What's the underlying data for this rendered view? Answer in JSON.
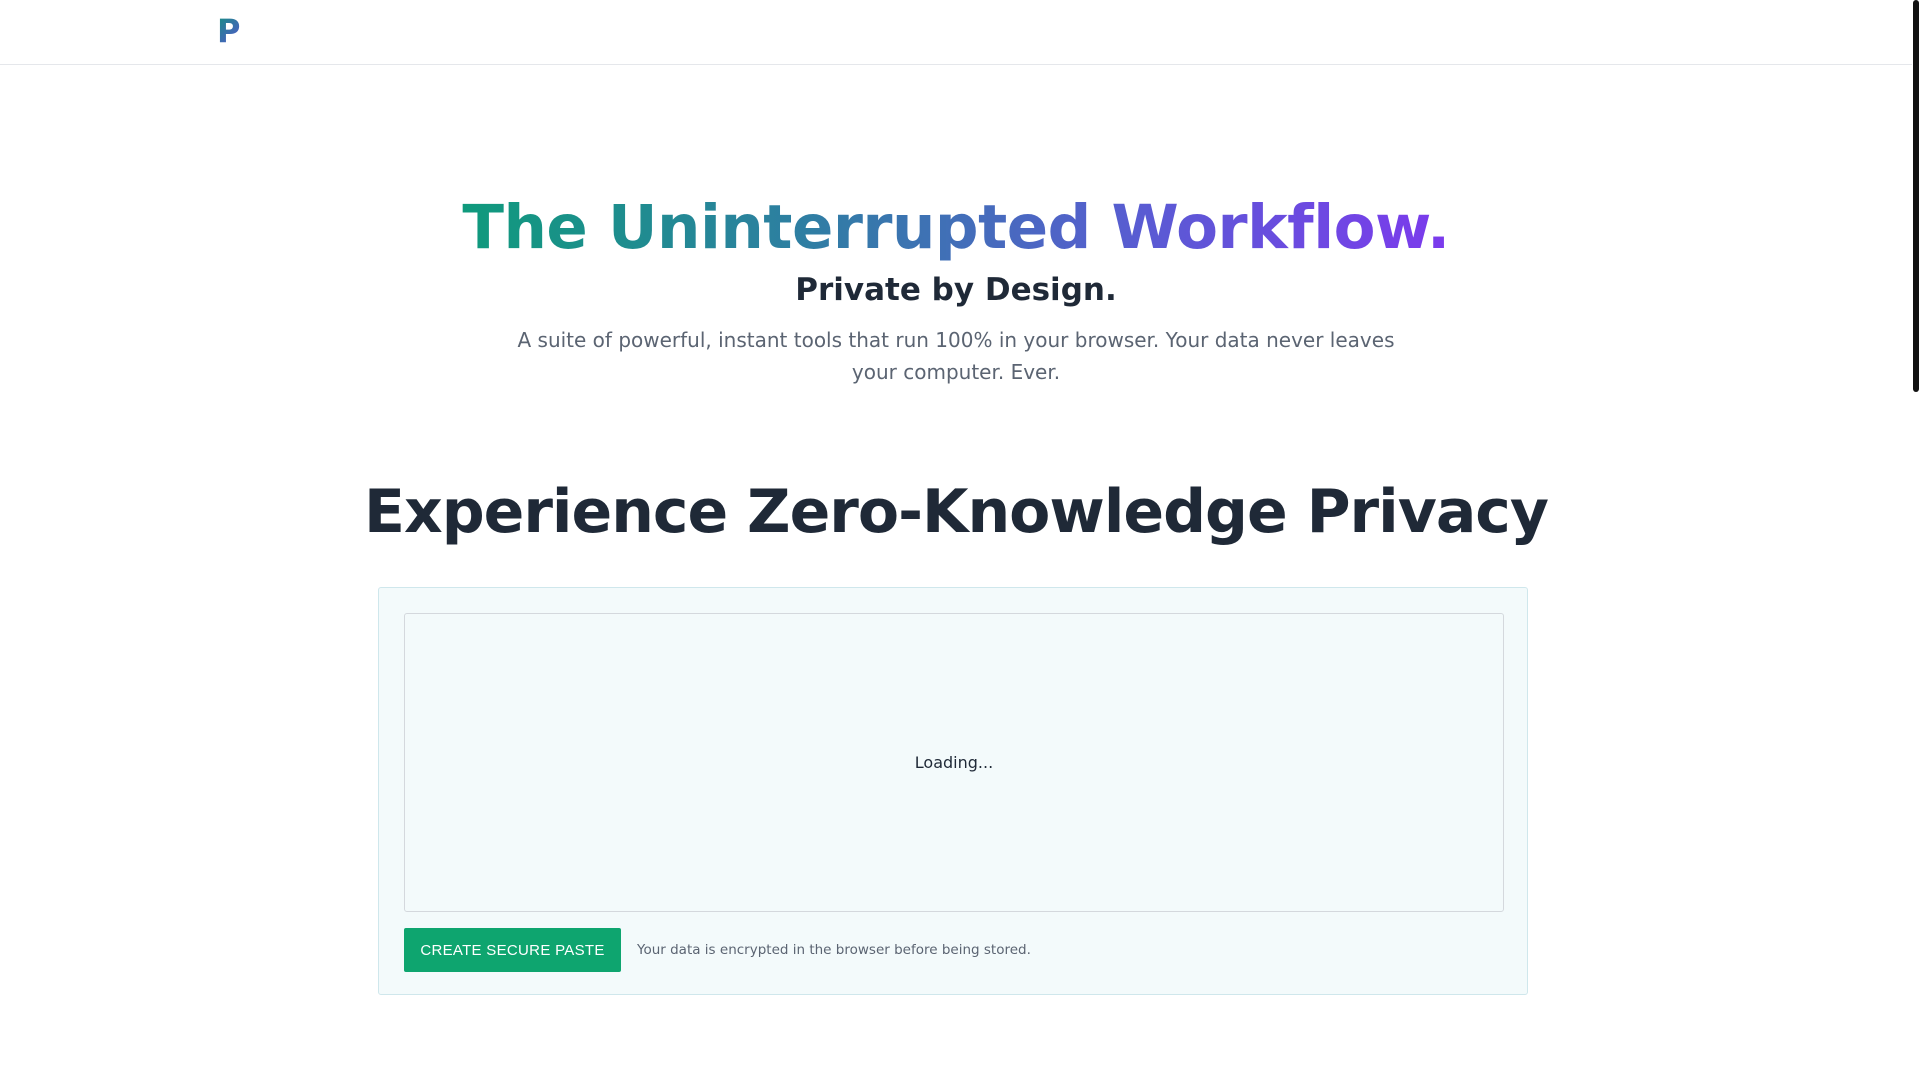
{
  "header": {
    "logo_text": "P"
  },
  "hero": {
    "title": "The Uninterrupted Workflow.",
    "subtitle": "Private by Design.",
    "description": "A suite of powerful, instant tools that run 100% in your browser. Your data never leaves your computer. Ever."
  },
  "section": {
    "title": "Experience Zero-Knowledge Privacy"
  },
  "paste": {
    "loading_text": "Loading...",
    "create_button_label": "CREATE SECURE PASTE",
    "encryption_note": "Your data is encrypted in the browser before being stored."
  },
  "colors": {
    "accent_green": "#0ea56f",
    "gradient_start": "#0f9a7c",
    "gradient_end": "#7c3aed",
    "card_background": "#f3fafb"
  }
}
